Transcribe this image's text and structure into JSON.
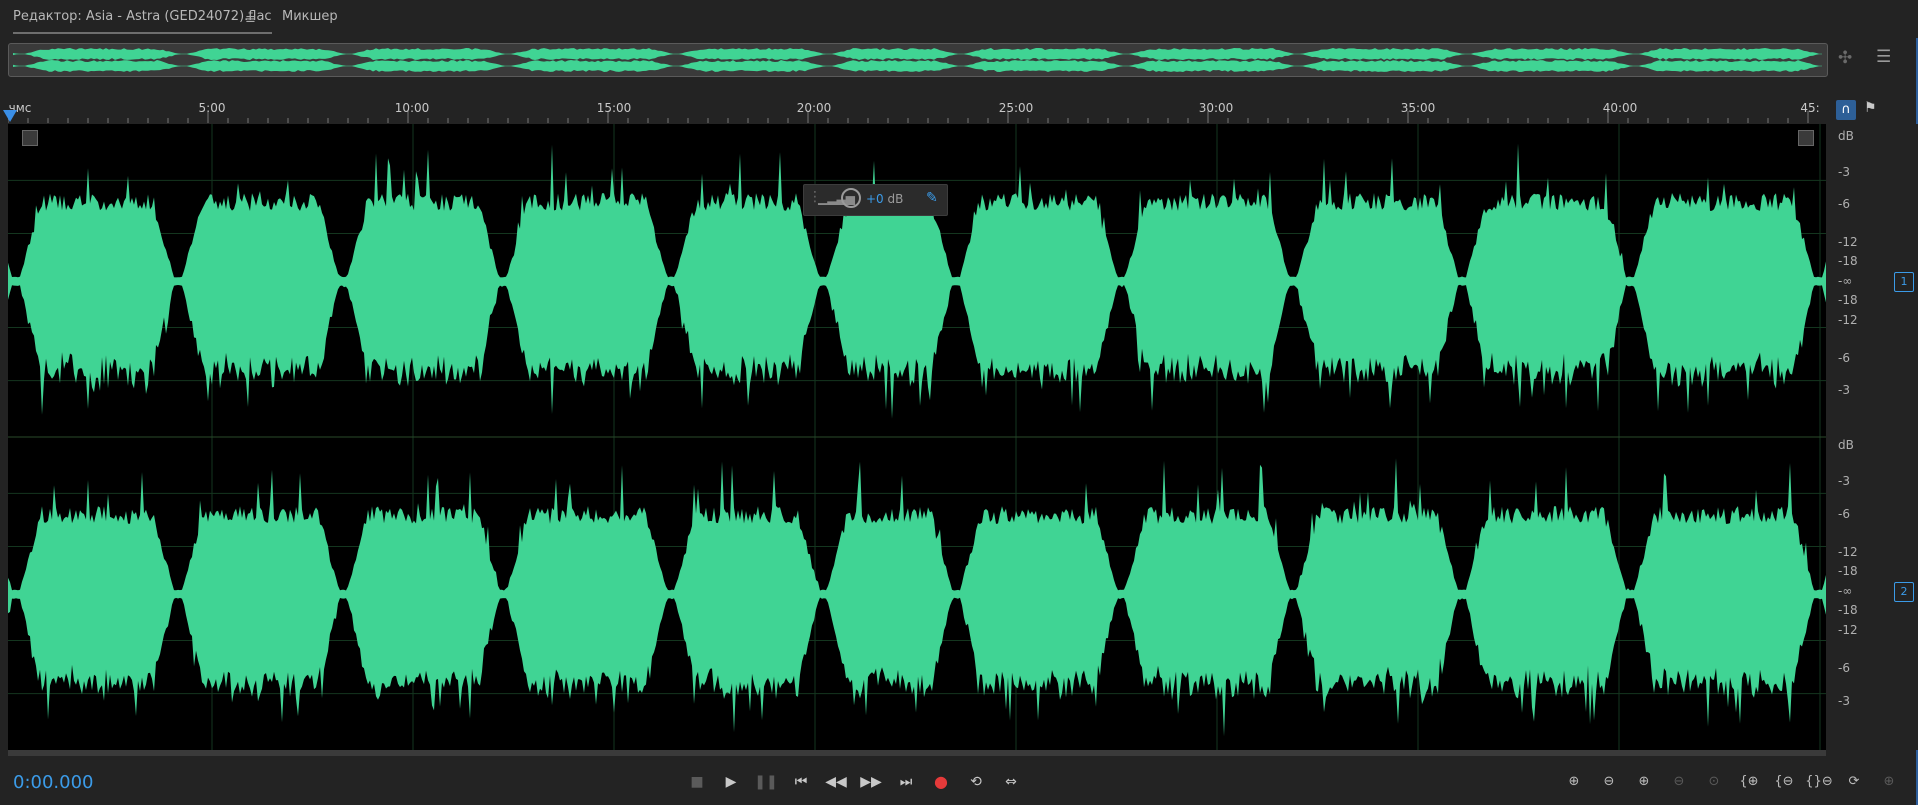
{
  "tabs": {
    "editor_label": "Редактор: Asia - Astra (GED24072).flac",
    "menu_icon": "hamburger-icon",
    "mixer_label": "Микшер"
  },
  "ruler": {
    "start_label": "чмс",
    "labels": [
      "5:00",
      "10:00",
      "15:00",
      "20:00",
      "25:00",
      "30:00",
      "35:00",
      "40:00",
      "45:"
    ]
  },
  "hud": {
    "value": "+0",
    "unit": "dB",
    "pin_icon": "pin-icon"
  },
  "db_scale": {
    "unit": "dB",
    "channel1": [
      "-3",
      "-6",
      "-12",
      "-18",
      "-∞",
      "-18",
      "-12",
      "-6",
      "-3"
    ],
    "channel2": [
      "-3",
      "-6",
      "-12",
      "-18",
      "-∞",
      "-18",
      "-12",
      "-6",
      "-3"
    ],
    "channel1_badge": "1",
    "channel2_badge": "2"
  },
  "transport": {
    "timecode": "0:00.000",
    "buttons": [
      "stop-icon",
      "play-icon",
      "pause-icon",
      "skip-back-icon",
      "rewind-icon",
      "fast-forward-icon",
      "skip-forward-icon",
      "record-icon",
      "loop-icon",
      "skip-selection-icon"
    ]
  },
  "zoom": {
    "buttons": [
      "zoom-in-amplitude-icon",
      "zoom-out-amplitude-icon",
      "zoom-in-time-icon",
      "zoom-out-full-icon",
      "zoom-selection-icon",
      "zoom-in-left-icon",
      "zoom-out-left-icon",
      "zoom-out-right-icon",
      "zoom-reset-icon",
      "zoom-disabled-icon"
    ]
  },
  "colors": {
    "waveform": "#40d494",
    "accent": "#3b9be8",
    "record": "#e53a3a"
  }
}
